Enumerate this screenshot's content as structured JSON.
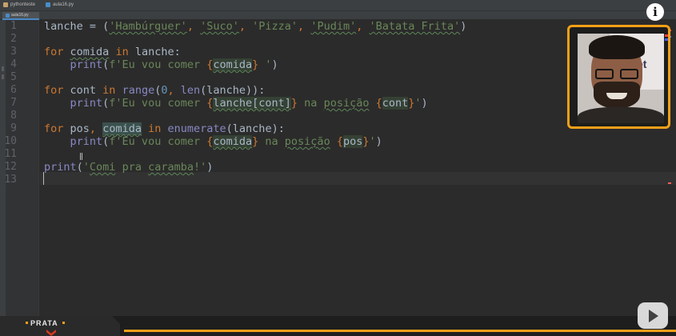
{
  "breadcrumb": {
    "project": "pythonteste",
    "file": "aula16.py"
  },
  "tab": {
    "label": "aula16.py"
  },
  "gutter": {
    "line_numbers": [
      "1",
      "2",
      "3",
      "4",
      "5",
      "6",
      "7",
      "8",
      "9",
      "10",
      "11",
      "12",
      "13"
    ]
  },
  "code": {
    "l1": {
      "a": "lanche = (",
      "s1": "'Hambúrguer'",
      "s2": "'Suco'",
      "s3": "'Pizza'",
      "s4": "'Pudim'",
      "s5": "'Batata Frita'",
      "close": ")",
      "sep": ", "
    },
    "l3": {
      "kw_for": "for",
      "var": "comida",
      "kw_in": "in",
      "rest": " lanche:"
    },
    "l4": {
      "indent": "    ",
      "fn": "print",
      "open": "(",
      "s_a": "f'Eu vou comer ",
      "lb": "{",
      "var": "comida",
      "rb": "}",
      "s_b": " '",
      "close": ")"
    },
    "l6": {
      "kw_for": "for",
      "mid1": " cont ",
      "kw_in": "in",
      "sp": " ",
      "range": "range",
      "open": "(",
      "zero": "0",
      "comma": ", ",
      "len": "len",
      "rest": "(lanche)):"
    },
    "l7": {
      "indent": "    ",
      "fn": "print",
      "open": "(",
      "s_a": "f'Eu vou comer ",
      "lb": "{",
      "expr": "lanche[cont]",
      "rb": "}",
      "s_b": " na ",
      "s_c": "posição",
      "sp": " ",
      "lb2": "{",
      "var2": "cont",
      "rb2": "}",
      "s_d": "'",
      "close": ")"
    },
    "l9": {
      "kw_for": "for",
      "mid1": " pos",
      "comma": ",",
      "sp": " ",
      "var": "comida",
      "kw_in": "in",
      "enum": "enumerate",
      "rest": "(lanche):"
    },
    "l10": {
      "indent": "    ",
      "fn": "print",
      "open": "(",
      "s_a": "f'Eu vou comer ",
      "lb": "{",
      "var": "comida",
      "rb": "}",
      "s_b": " na ",
      "s_c": "posição",
      "sp": " ",
      "lb2": "{",
      "var2": "pos",
      "rb2": "}",
      "s_d": "'",
      "close": ")"
    },
    "l12": {
      "fn": "print",
      "open": "(",
      "q": "'",
      "w1": "Comi",
      "mid": " pra ",
      "w2": "caramba",
      "end": "!'",
      "close": ")"
    }
  },
  "overlay": {
    "info_glyph": "i",
    "webcam_logo": "et",
    "badge_label": "PRATA"
  },
  "colors": {
    "accent": "#f2a017",
    "editor_bg": "#2b2b2b",
    "keyword": "#cc7832",
    "string": "#6a8759",
    "number": "#6897bb",
    "builtin": "#8888c6"
  },
  "icons": {
    "info": "info-icon",
    "youtube": "youtube-icon",
    "folder": "folder-icon",
    "python_file": "python-file-icon"
  }
}
